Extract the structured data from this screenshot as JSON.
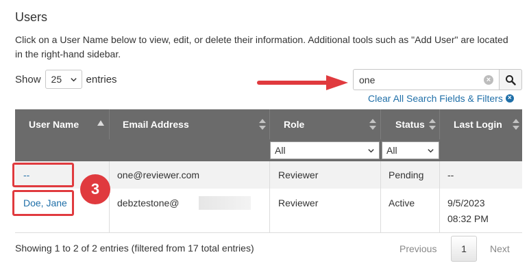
{
  "page": {
    "title": "Users",
    "intro": "Click on a User Name below to view, edit, or delete their information. Additional tools such as \"Add User\" are located in the right-hand sidebar."
  },
  "length_control": {
    "prefix": "Show",
    "value": "25",
    "suffix": "entries"
  },
  "search": {
    "value": "one",
    "clear_all_label": "Clear All Search Fields & Filters"
  },
  "table": {
    "columns": [
      "User Name",
      "Email Address",
      "Role",
      "Status",
      "Last Login"
    ],
    "filters": {
      "role": "All",
      "status": "All"
    },
    "rows": [
      {
        "user_name": "--",
        "email": "one@reviewer.com",
        "role": "Reviewer",
        "status": "Pending",
        "last_login": "--"
      },
      {
        "user_name": "Doe, Jane",
        "email": "debztestone@",
        "role": "Reviewer",
        "status": "Active",
        "last_login_date": "9/5/2023",
        "last_login_time": "08:32 PM"
      }
    ]
  },
  "annotation": {
    "step": "3"
  },
  "footer": {
    "info": "Showing 1 to 2 of 2 entries (filtered from 17 total entries)",
    "previous": "Previous",
    "page": "1",
    "next": "Next"
  },
  "colors": {
    "accent": "#1f6fa8",
    "header_bg": "#6b6b6b",
    "highlight": "#e03a3e"
  }
}
